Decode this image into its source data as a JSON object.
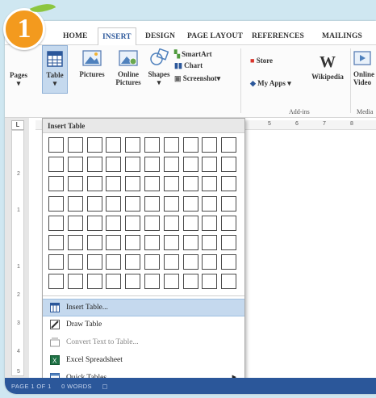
{
  "step_badge": {
    "number": "1"
  },
  "tabs": [
    "HOME",
    "INSERT",
    "DESIGN",
    "PAGE LAYOUT",
    "REFERENCES",
    "MAILINGS"
  ],
  "active_tab": "INSERT",
  "ribbon": {
    "pages": "Pages",
    "table": "Table",
    "pictures": "Pictures",
    "online_pictures_1": "Online",
    "online_pictures_2": "Pictures",
    "shapes": "Shapes",
    "smartart": "SmartArt",
    "chart": "Chart",
    "screenshot": "Screenshot",
    "store": "Store",
    "my_apps": "My Apps",
    "wikipedia": "Wikipedia",
    "addins_group": "Add-ins",
    "online_video_1": "Online",
    "online_video_2": "Video",
    "media_group": "Media"
  },
  "ruler": {
    "h_labels": [
      "5",
      "6",
      "7",
      "8"
    ],
    "v_labels": [
      "2",
      "1",
      "1",
      "2",
      "3",
      "4",
      "5"
    ]
  },
  "dropdown": {
    "header": "Insert Table",
    "grid_rows": 8,
    "grid_cols": 10,
    "items": [
      {
        "label": "Insert Table...",
        "highlighted": true,
        "disabled": false,
        "submenu": false
      },
      {
        "label": "Draw Table",
        "highlighted": false,
        "disabled": false,
        "submenu": false
      },
      {
        "label": "Convert Text to Table...",
        "highlighted": false,
        "disabled": true,
        "submenu": false
      },
      {
        "label": "Excel Spreadsheet",
        "highlighted": false,
        "disabled": false,
        "submenu": false
      },
      {
        "label": "Quick Tables",
        "highlighted": false,
        "disabled": false,
        "submenu": true
      }
    ]
  },
  "status_bar": {
    "page": "PAGE 1 OF 1",
    "words": "0 WORDS"
  },
  "colors": {
    "accent": "#2b579a",
    "highlight": "#c5d9ee",
    "badge": "#f39a1e"
  }
}
